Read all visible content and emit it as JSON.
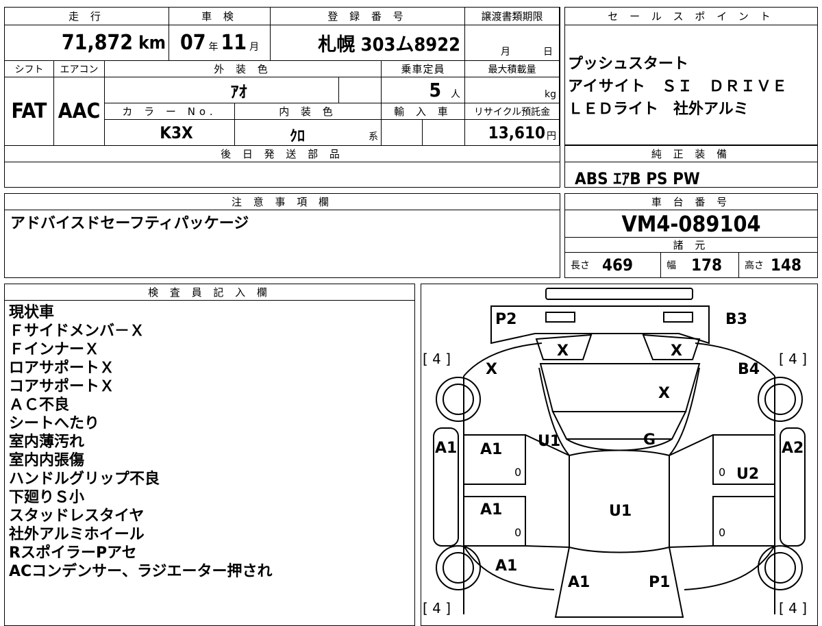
{
  "vehicle": {
    "mileage_label": "走 行",
    "mileage_value": "71,872",
    "mileage_unit": "km",
    "inspection_label": "車 検",
    "inspection_year": "07",
    "inspection_year_unit": "年",
    "inspection_month": "11",
    "inspection_month_unit": "月",
    "registration_label": "登 録 番 号",
    "registration_value": "札幌 303ム8922",
    "transfer_label": "譲渡書類期限",
    "transfer_month_unit": "月",
    "transfer_day_unit": "日",
    "shift_label": "シフト",
    "shift_value": "FAT",
    "aircon_label": "エアコン",
    "aircon_value": "AAC",
    "exterior_label": "外 装 色",
    "exterior_value": "ｱｵ",
    "capacity_label": "乗車定員",
    "capacity_value": "5",
    "capacity_unit": "人",
    "max_load_label": "最大積載量",
    "max_load_unit": "kg",
    "color_no_label": "カ ラ ー No.",
    "color_no_value": "K3X",
    "interior_label": "内 装 色",
    "interior_value": "ｸﾛ",
    "interior_unit": "系",
    "import_label": "輸 入 車",
    "recycle_label": "リサイクル預託金",
    "recycle_value": "13,610",
    "recycle_unit": "円",
    "later_parts_label": "後 日 発 送 部 品"
  },
  "sales": {
    "label": "セ ー ル ス ポ イ ン ト",
    "lines": [
      "プッシュスタート",
      "アイサイト　ＳＩ　ＤＲＩＶＥ",
      "ＬＥＤライト　社外アルミ"
    ]
  },
  "equipment": {
    "label": "純 正 装 備",
    "value": "ABS ｴｱB PS PW"
  },
  "notes": {
    "label": "注 意 事 項 欄",
    "value": "アドバイスドセーフティパッケージ"
  },
  "chassis": {
    "label": "車 台 番 号",
    "value": "VM4-089104",
    "specs_label": "諸 元",
    "length_label": "長さ",
    "length_value": "469",
    "width_label": "幅",
    "width_value": "178",
    "height_label": "高さ",
    "height_value": "148"
  },
  "inspector": {
    "label": "検 査 員 記 入 欄",
    "lines": [
      "現状車",
      "Ｆサイドメンバ－Ｘ",
      "ＦインナーＸ",
      "ロアサポートＸ",
      "コアサポートＸ",
      "ＡＣ不良",
      "シートへたり",
      "室内薄汚れ",
      "室内内張傷",
      "ハンドルグリップ不良",
      "下廻りＳ小",
      "スタッドレスタイヤ",
      "社外アルミホイール",
      "RスポイラーPアセ",
      "ACコンデンサー、ラジエーター押され"
    ]
  },
  "diagram": {
    "marks": {
      "p2": "P2",
      "b3": "B3",
      "x_l": "X",
      "x_r": "X",
      "x_fl": "X",
      "b4": "B4",
      "x_hood": "X",
      "a1_fl": "A1",
      "a2_fr": "A2",
      "a1_fd": "A1",
      "u1_cowl": "U1",
      "g_glass": "G",
      "u2_fd": "U2",
      "a1_rd": "A1",
      "u1_roof": "U1",
      "a1_rq": "A1",
      "a1_trunk": "A1",
      "p1_trunk": "P1",
      "tire_fl": "[ 4 ]",
      "tire_fr": "[ 4 ]",
      "tire_rl": "[ 4 ]",
      "tire_rr": "[ 4 ]",
      "zero_1": "0",
      "zero_2": "0",
      "zero_3": "0",
      "zero_4": "0"
    }
  }
}
